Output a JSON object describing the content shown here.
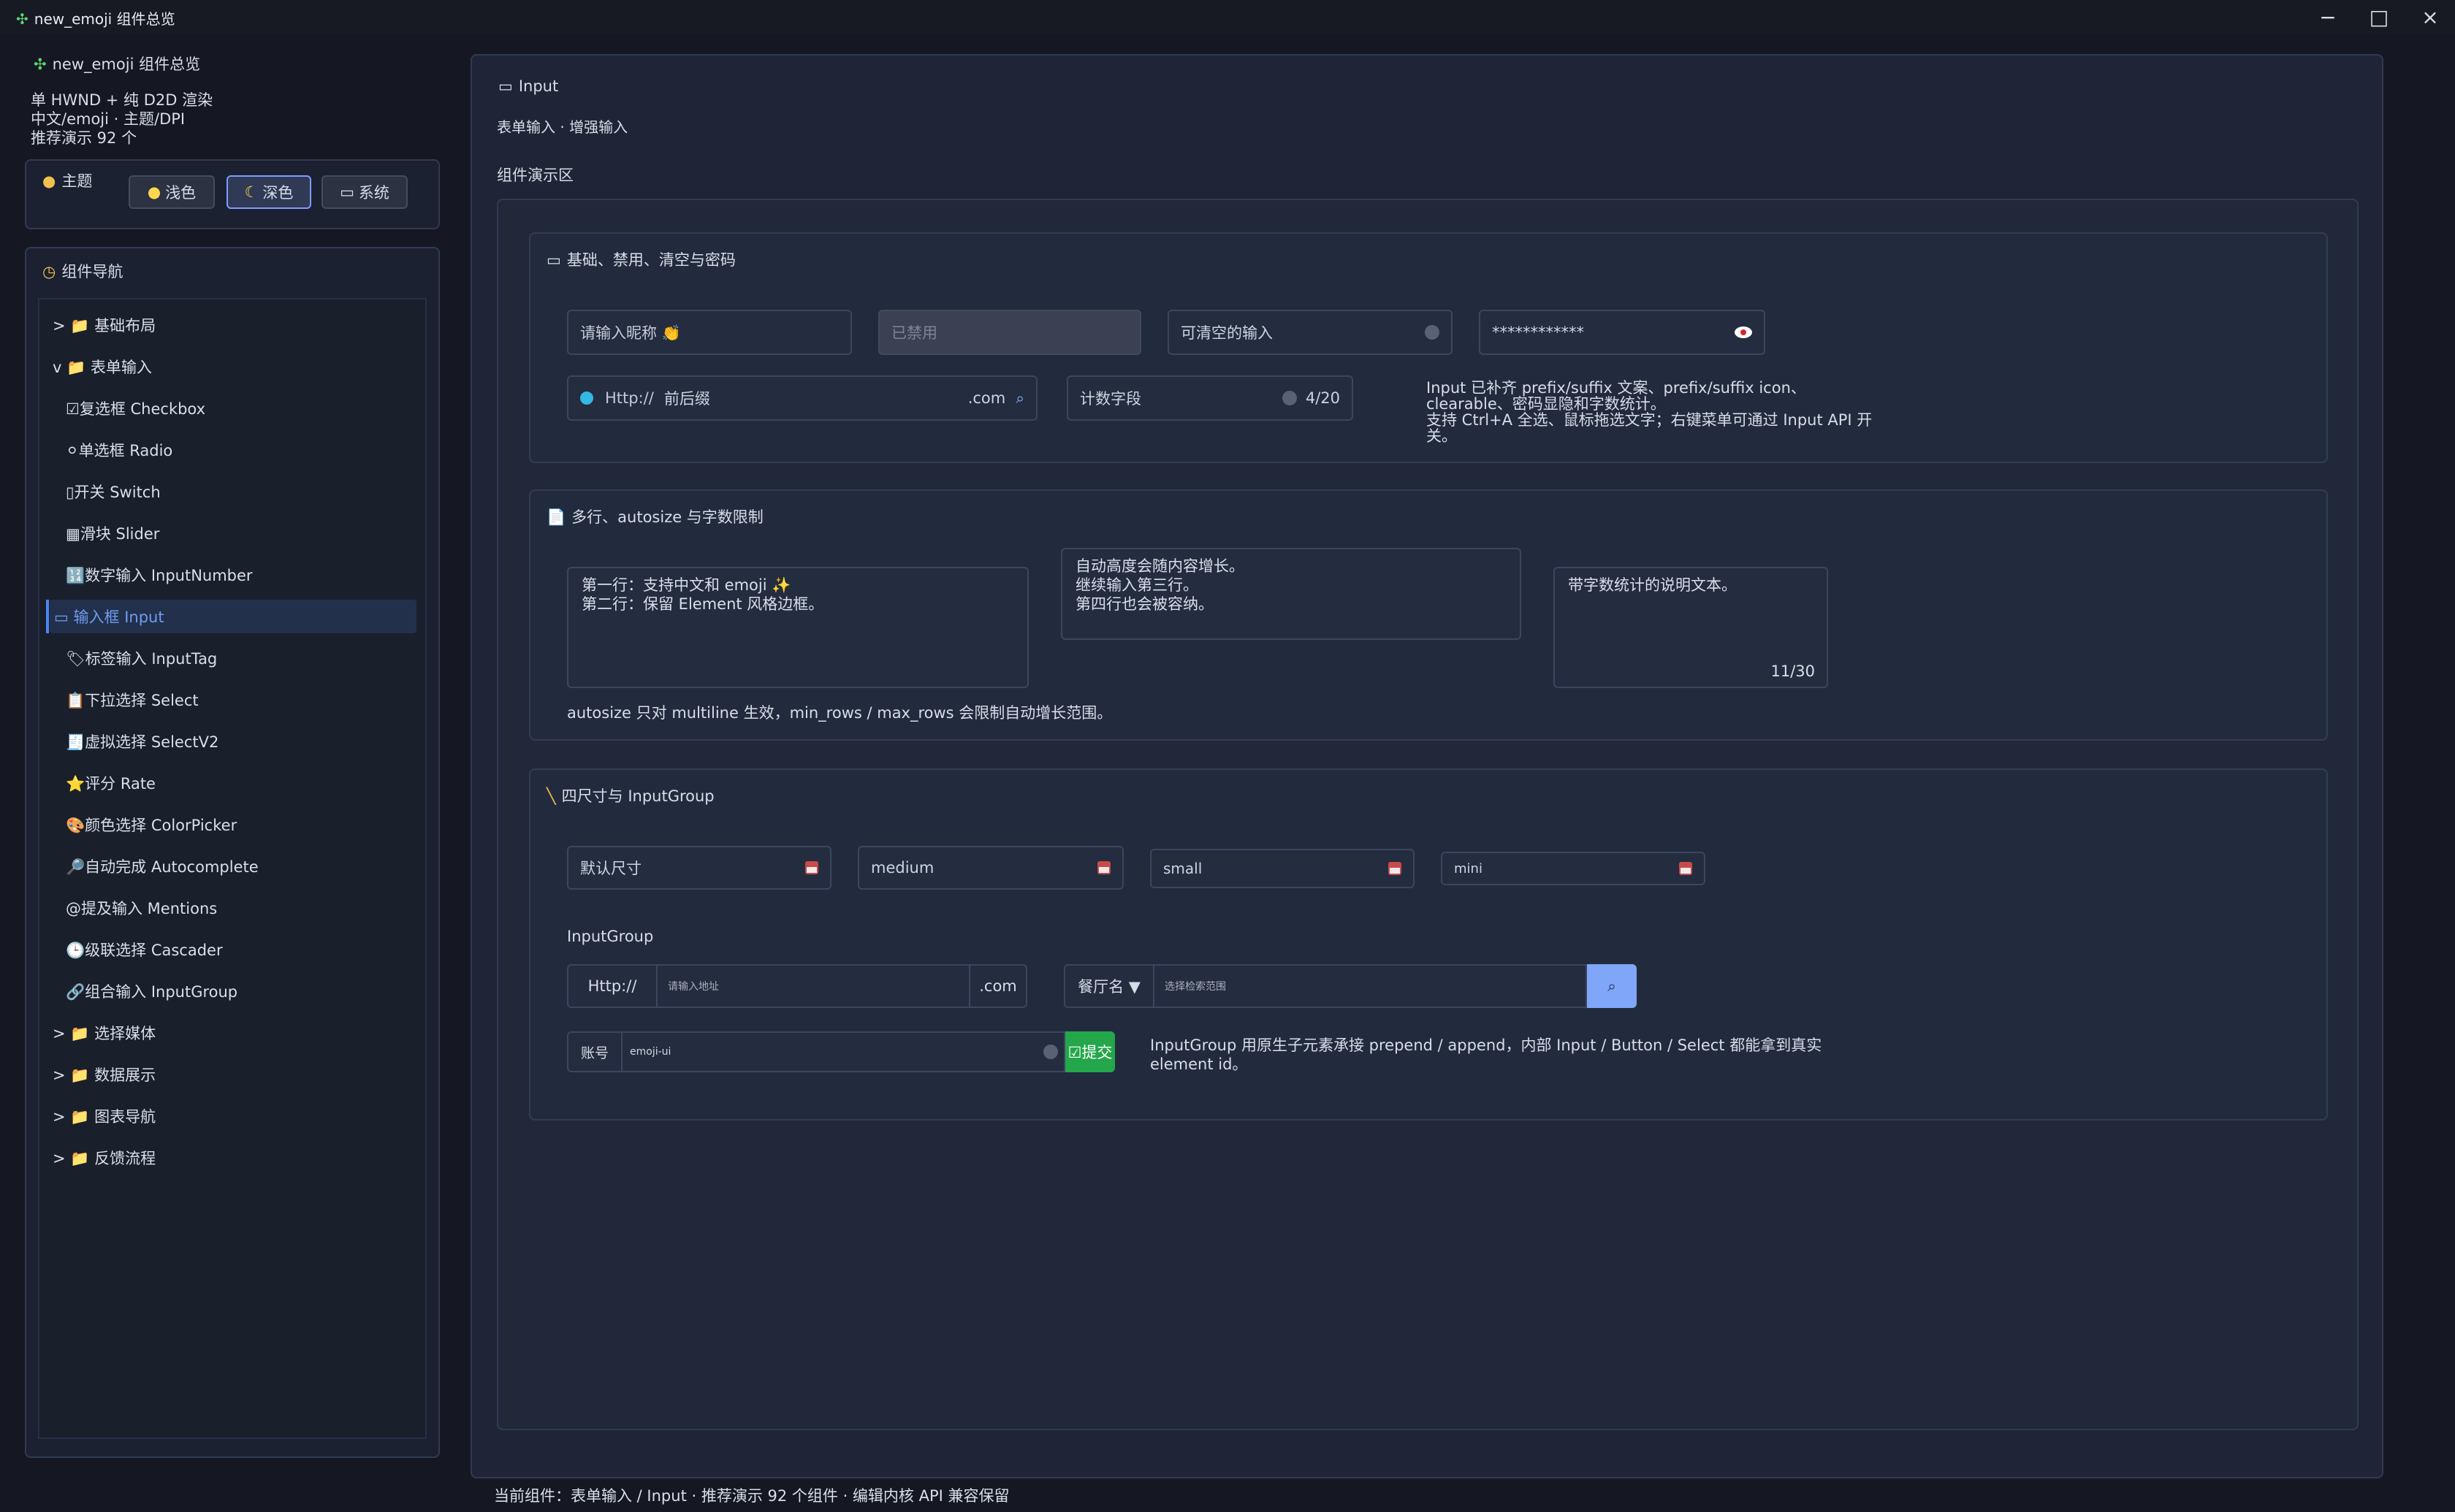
{
  "window": {
    "title": "new_emoji 组件总览"
  },
  "sidebar": {
    "title": "new_emoji 组件总览",
    "lines": [
      "单 HWND + 纯 D2D 渲染",
      "中文/emoji · 主题/DPI",
      "推荐演示 92 个"
    ],
    "theme": {
      "label": "主题",
      "options": [
        "浅色",
        "深色",
        "系统"
      ],
      "selected": "深色"
    },
    "nav": {
      "title": "组件导航",
      "items": [
        {
          "label": "> 📁 基础布局"
        },
        {
          "label": "v 📁 表单输入"
        },
        {
          "label": "☑复选框 Checkbox"
        },
        {
          "label": "⚪单选框 Radio"
        },
        {
          "label": "▯开关 Switch"
        },
        {
          "label": "▦滑块 Slider"
        },
        {
          "label": "🔢数字输入 InputNumber"
        },
        {
          "label": "▭ 输入框 Input"
        },
        {
          "label": "🏷标签输入 InputTag"
        },
        {
          "label": "📋下拉选择 Select"
        },
        {
          "label": "🧾虚拟选择 SelectV2"
        },
        {
          "label": "⭐评分 Rate"
        },
        {
          "label": "🎨颜色选择 ColorPicker"
        },
        {
          "label": "🔎自动完成 Autocomplete"
        },
        {
          "label": "@提及输入 Mentions"
        },
        {
          "label": "🕒级联选择 Cascader"
        },
        {
          "label": "🔗组合输入 InputGroup"
        },
        {
          "label": "> 📁 选择媒体"
        },
        {
          "label": "> 📁 数据展示"
        },
        {
          "label": "> 📁 图表导航"
        },
        {
          "label": "> 📁 反馈流程"
        }
      ]
    }
  },
  "main": {
    "title": "Input",
    "subtitle": "表单输入 · 增强输入",
    "demo_label": "组件演示区",
    "section1": {
      "title": "基础、禁用、清空与密码",
      "inputs": [
        "请输入昵称 👏",
        "已禁用",
        "可清空的输入",
        "************"
      ],
      "prefix": "Http://",
      "prefix_value": "前后缀",
      "suffix": ".com",
      "count_label": "计数字段",
      "count": "4/20",
      "note": "Input 已补齐 prefix/suffix 文案、prefix/suffix icon、clearable、密码显隐和字数统计。\n支持 Ctrl+A 全选、鼠标拖选文字；右键菜单可通过 Input API 开关。"
    },
    "section2": {
      "title": "多行、autosize 与字数限制",
      "area1": "第一行：支持中文和 emoji ✨\n第二行：保留 Element 风格边框。",
      "area2": "自动高度会随内容增长。\n继续输入第三行。\n第四行也会被容纳。",
      "area3": "带字数统计的说明文本。",
      "area3_count": "11/30",
      "note": "autosize 只对 multiline 生效，min_rows / max_rows 会限制自动增长范围。"
    },
    "section3": {
      "title": "四尺寸与 InputGroup",
      "sizes": [
        "默认尺寸",
        "medium",
        "small",
        "mini"
      ],
      "group_title": "InputGroup",
      "g1_prefix": "Http://",
      "g1_placeholder": "请输入地址",
      "g1_suffix": ".com",
      "g2_select": "餐厅名 ▼",
      "g2_placeholder": "选择检索范围",
      "g3_label": "账号",
      "g3_value": "emoji-ui",
      "submit": "☑提交",
      "note": "InputGroup 用原生子元素承接 prepend / append，内部 Input / Button / Select 都能拿到真实 element id。"
    }
  },
  "footer": {
    "text": "当前组件：表单输入 / Input · 推荐演示 92 个组件 · 编辑内核 API 兼容保留"
  }
}
